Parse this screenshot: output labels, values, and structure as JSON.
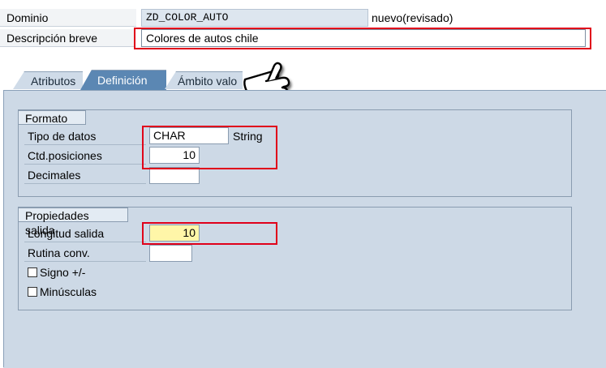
{
  "header": {
    "dominio_label": "Dominio",
    "dominio_value": "ZD_COLOR_AUTO",
    "status": "nuevo(revisado)",
    "descripcion_label": "Descripción breve",
    "descripcion_value": "Colores de autos chile"
  },
  "tabs": [
    {
      "label": "Atributos",
      "active": false
    },
    {
      "label": "Definición",
      "active": true
    },
    {
      "label": "Ámbito valo",
      "active": false
    }
  ],
  "formato": {
    "title": "Formato",
    "tipo_label": "Tipo de datos",
    "tipo_value": "CHAR",
    "tipo_desc": "String",
    "ctd_label": "Ctd.posiciones",
    "ctd_value": "10",
    "decimales_label": "Decimales",
    "decimales_value": ""
  },
  "propiedades": {
    "title": "Propiedades salida",
    "longitud_label": "Longitud salida",
    "longitud_value": "10",
    "rutina_label": "Rutina conv.",
    "rutina_value": "",
    "signo_label": "Signo +/-",
    "minusculas_label": "Minúsculas"
  },
  "colors": {
    "highlight": "#e0001a",
    "panel": "#cdd9e6",
    "active_tab": "#5b87b3",
    "required_field": "#fff6a8"
  },
  "icons": [
    "pointing-hand-cursor-icon",
    "checkbox-icon"
  ]
}
